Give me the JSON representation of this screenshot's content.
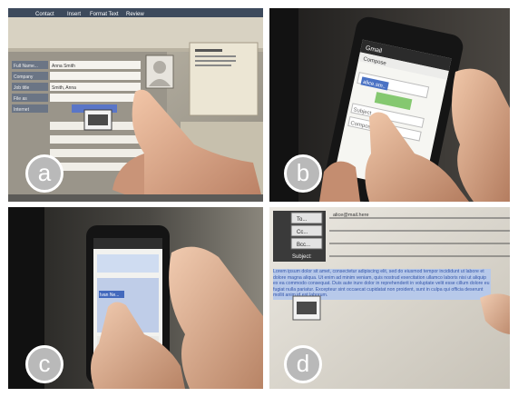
{
  "panels": [
    {
      "label": "a"
    },
    {
      "label": "b"
    },
    {
      "label": "c"
    },
    {
      "label": "d"
    }
  ],
  "panel_a": {
    "ribbon_tabs": [
      "Contact",
      "Insert",
      "Format Text",
      "Review"
    ],
    "field_labels": [
      "Full Name...",
      "Company",
      "Job title",
      "File as",
      "Internet"
    ],
    "name_value": "Anna Smith",
    "job_value": "Smith, Anna"
  },
  "panel_b": {
    "app_title": "Gmail",
    "compose_label": "Compose",
    "to_value": "alice.sm..",
    "subject_label": "Subject",
    "compose_body_label": "Compose mail"
  },
  "panel_c": {
    "chip_text": "Ivan Ne..."
  },
  "panel_d": {
    "to_button": "To...",
    "cc_button": "Cc...",
    "bcc_button": "Bcc...",
    "subject_label": "Subject:",
    "to_value": "alice@mail.here",
    "body_text": "Lorem ipsum dolor sit amet, consectetur adipiscing elit, sed do eiusmod tempor incididunt ut labore et dolore magna aliqua. Ut enim ad minim veniam, quis nostrud exercitation ullamco laboris nisi ut aliquip ex ea commodo consequat. Duis aute irure dolor in reprehenderit in voluptate velit esse cillum dolore eu fugiat nulla pariatur. Excepteur sint occaecat cupidatat non proident, sunt in culpa qui officia deserunt mollit anim id est laborum."
  }
}
